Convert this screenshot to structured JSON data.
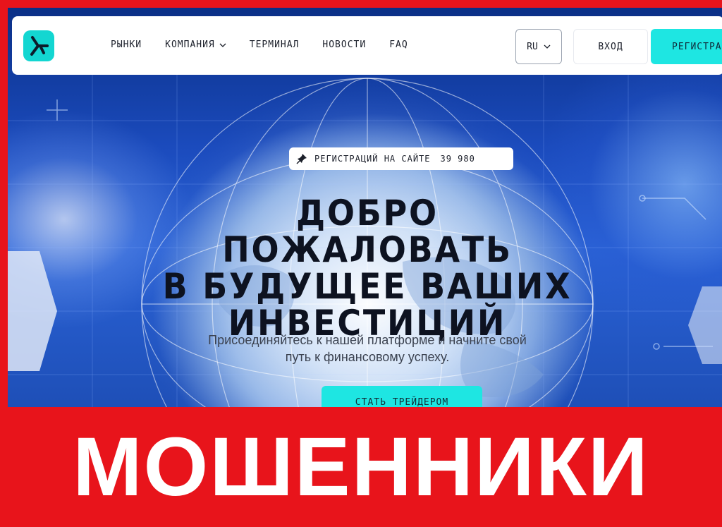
{
  "header": {
    "logo_icon": "brand-logo-icon",
    "nav": [
      {
        "label": "РЫНКИ",
        "has_dropdown": false
      },
      {
        "label": "КОМПАНИЯ",
        "has_dropdown": true
      },
      {
        "label": "ТЕРМИНАЛ",
        "has_dropdown": false
      },
      {
        "label": "НОВОСТИ",
        "has_dropdown": false
      },
      {
        "label": "FAQ",
        "has_dropdown": false
      }
    ],
    "language": {
      "selected": "RU",
      "icon": "chevron-down-icon"
    },
    "login_label": "ВХОД",
    "register_label": "РЕГИСТРАЦИЯ"
  },
  "badge": {
    "icon": "pin-icon",
    "label": "РЕГИСТРАЦИЙ НА САЙТЕ",
    "count": "39 980"
  },
  "hero": {
    "title_lines": [
      "ДОБРО ПОЖАЛОВАТЬ",
      "В БУДУЩЕЕ ВАШИХ",
      "ИНВЕСТИЦИЙ"
    ],
    "subtitle_lines": [
      "Присоединяйтесь к нашей платформе и начните свой",
      "путь к финансовому успеху."
    ],
    "cta_label": "СТАТЬ ТРЕЙДЕРОМ"
  },
  "banner": {
    "text": "МОШЕННИКИ"
  },
  "colors": {
    "frame_red": "#e8141b",
    "accent_cyan": "#1ee6e2",
    "background_blue": "#1b4bbd"
  }
}
